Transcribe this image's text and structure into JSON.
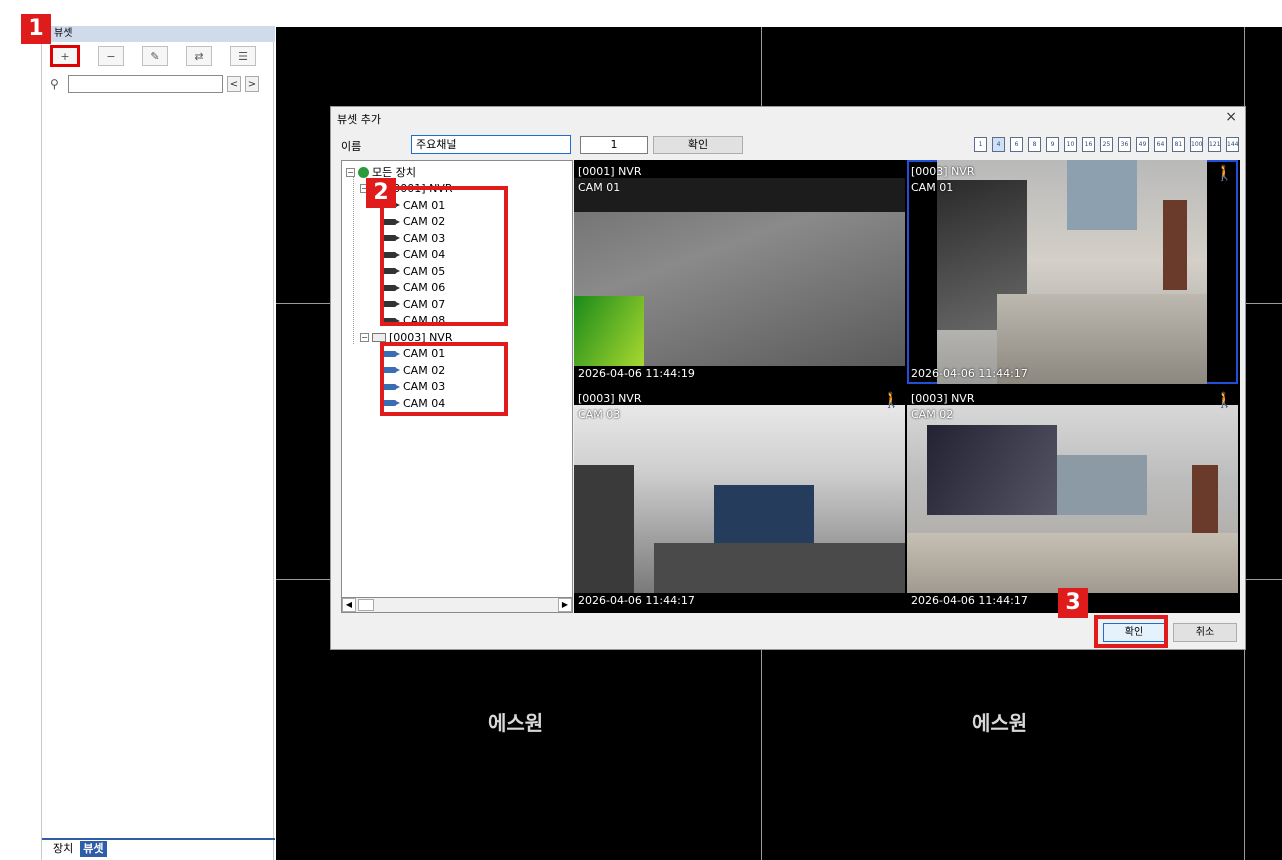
{
  "left_panel": {
    "header": "뷰셋",
    "toolbar": [
      {
        "icon": "add-icon",
        "glyph": "+"
      },
      {
        "icon": "remove-icon",
        "glyph": "−"
      },
      {
        "icon": "edit-icon",
        "glyph": "✎"
      },
      {
        "icon": "link-icon",
        "glyph": "⇄"
      },
      {
        "icon": "list-icon",
        "glyph": "☰"
      }
    ],
    "search": {
      "icon": "search-icon",
      "value": "",
      "prev": "<",
      "next": ">"
    },
    "tabs": [
      "장치",
      "뷰셋"
    ],
    "active_tab": "뷰셋"
  },
  "wall": {
    "labels": [
      "에스원",
      "에스원"
    ]
  },
  "badges": [
    "1",
    "2",
    "3"
  ],
  "dialog": {
    "title": "뷰셋 추가",
    "close": "×",
    "name_label": "이름",
    "name_value": "주요채널",
    "number_value": "1",
    "confirm_top": "확인",
    "layouts": [
      "1",
      "4",
      "6",
      "8",
      "9",
      "10",
      "16",
      "25",
      "36",
      "49",
      "64",
      "81",
      "100",
      "121",
      "144"
    ],
    "tree": {
      "root": "모든 장치",
      "groups": [
        {
          "name": "[0001] NVR",
          "cams": [
            "CAM 01",
            "CAM 02",
            "CAM 03",
            "CAM 04",
            "CAM 05",
            "CAM 06",
            "CAM 07",
            "CAM 08"
          ]
        },
        {
          "name": "[0003] NVR",
          "cams": [
            "CAM 01",
            "CAM 02",
            "CAM 03",
            "CAM 04"
          ]
        }
      ]
    },
    "tiles": [
      {
        "nvr": "[0001] NVR",
        "cam": "CAM 01",
        "time": "2026-04-06  11:44:19",
        "motion": false,
        "selected": false
      },
      {
        "nvr": "[0003] NVR",
        "cam": "CAM 01",
        "time": "2026-04-06  11:44:17",
        "motion": true,
        "selected": true
      },
      {
        "nvr": "[0003] NVR",
        "cam": "CAM 03",
        "time": "2026-04-06  11:44:17",
        "motion": true,
        "selected": false
      },
      {
        "nvr": "[0003] NVR",
        "cam": "CAM 02",
        "time": "2026-04-06  11:44:17",
        "motion": true,
        "selected": false
      }
    ],
    "ok": "확인",
    "cancel": "취소"
  },
  "colors": {
    "highlight": "#e01b1b",
    "selection": "#2050d8",
    "tab_active": "#2f5ea8"
  }
}
